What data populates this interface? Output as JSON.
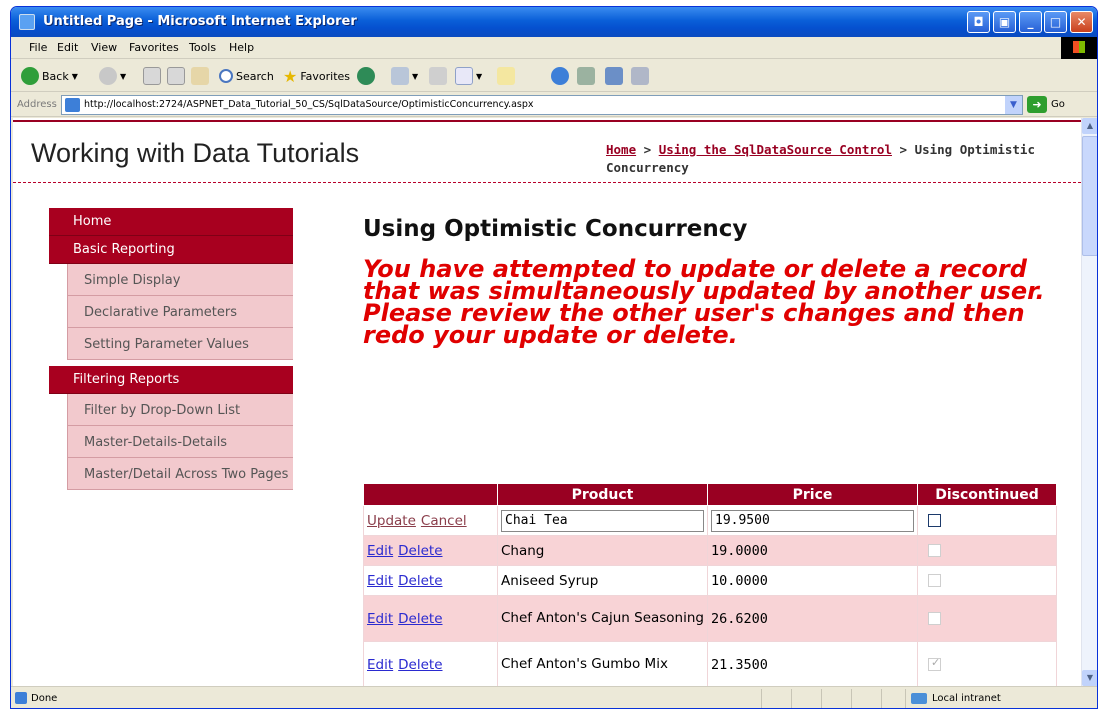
{
  "window": {
    "title": "Untitled Page - Microsoft Internet Explorer"
  },
  "menu": [
    "File",
    "Edit",
    "View",
    "Favorites",
    "Tools",
    "Help"
  ],
  "toolbar": {
    "back": "Back",
    "search": "Search",
    "favorites": "Favorites"
  },
  "address": {
    "label": "Address",
    "url": "http://localhost:2724/ASPNET_Data_Tutorial_50_CS/SqlDataSource/OptimisticConcurrency.aspx",
    "go": "Go"
  },
  "site": {
    "title": "Working with Data Tutorials",
    "breadcrumb": {
      "home": "Home",
      "sep1": " > ",
      "section": "Using the SqlDataSource Control",
      "sep2": " > ",
      "current": "Using Optimistic Concurrency"
    }
  },
  "sidebar": {
    "home": "Home",
    "basic": "Basic Reporting",
    "basic_items": [
      "Simple Display",
      "Declarative Parameters",
      "Setting Parameter Values"
    ],
    "filtering": "Filtering Reports",
    "filtering_items": [
      "Filter by Drop-Down List",
      "Master-Details-Details",
      "Master/Detail Across Two Pages"
    ]
  },
  "main": {
    "heading": "Using Optimistic Concurrency",
    "warning": "You have attempted to update or delete a record that was simultaneously updated by another user. Please review the other user's changes and then redo your update or delete."
  },
  "grid": {
    "headers": [
      "",
      "Product",
      "Price",
      "Discontinued"
    ],
    "update_label": "Update",
    "cancel_label": "Cancel",
    "edit_label": "Edit",
    "delete_label": "Delete",
    "editing": {
      "product": "Chai Tea",
      "price": "19.9500",
      "discontinued": false
    },
    "rows": [
      {
        "product": "Chang",
        "price": "19.0000",
        "discontinued": false
      },
      {
        "product": "Aniseed Syrup",
        "price": "10.0000",
        "discontinued": false
      },
      {
        "product": "Chef Anton's Cajun Seasoning",
        "price": "26.6200",
        "discontinued": false
      },
      {
        "product": "Chef Anton's Gumbo Mix",
        "price": "21.3500",
        "discontinued": true
      }
    ]
  },
  "status": {
    "text": "Done",
    "zone": "Local intranet"
  }
}
